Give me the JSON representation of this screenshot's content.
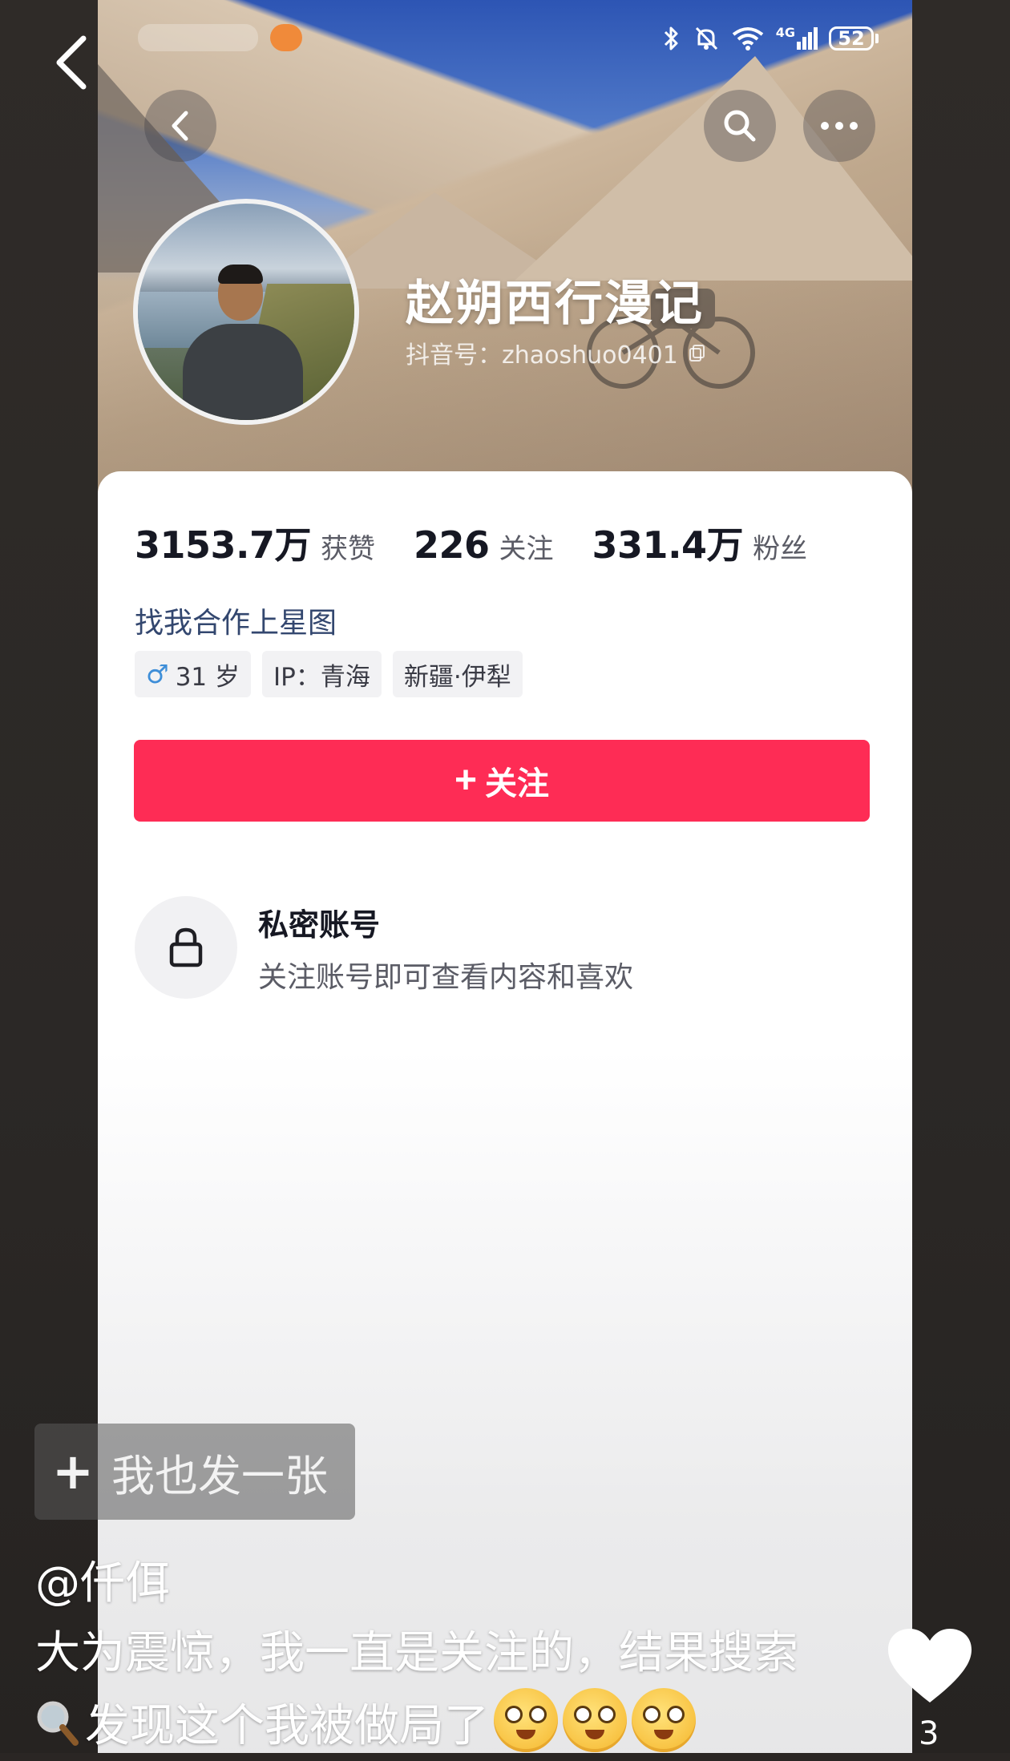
{
  "profile": {
    "name": "赵朔西行漫记",
    "douyin_id": "抖音号：zhaoshuo0401"
  },
  "status_bar": {
    "network": "4G",
    "battery": "52"
  },
  "stats": [
    {
      "value": "3153.7万",
      "label": "获赞"
    },
    {
      "value": "226",
      "label": "关注"
    },
    {
      "value": "331.4万",
      "label": "粉丝"
    }
  ],
  "star_link": "找我合作上星图",
  "tags": {
    "gender_symbol": "♂",
    "age": "31 岁",
    "ip": "IP：青海",
    "location": "新疆·伊犁"
  },
  "follow_button": {
    "plus": "+",
    "label": "关注"
  },
  "private_account": {
    "title": "私密账号",
    "description": "关注账号即可查看内容和喜欢"
  },
  "share_button": {
    "plus": "+",
    "label": "我也发一张"
  },
  "post": {
    "author": "@仟佴",
    "caption_line1": "大为震惊，我一直是关注的，结果搜索",
    "caption_line2": "发现这个我被做局了",
    "like_count": "3"
  },
  "colors": {
    "follow_button_bg": "#fe2c55",
    "link_color": "#33476f",
    "gender_icon": "#3e8ed8"
  },
  "icons": {
    "outer_back": "chevron-left-icon",
    "profile_back": "chevron-left-icon",
    "search": "search-icon",
    "more": "more-horizontal-icon",
    "lock": "lock-icon",
    "copy": "copy-icon",
    "like": "heart-icon",
    "search_glyph": "magnifier-icon",
    "emoji": "smiling-face-emoji"
  }
}
